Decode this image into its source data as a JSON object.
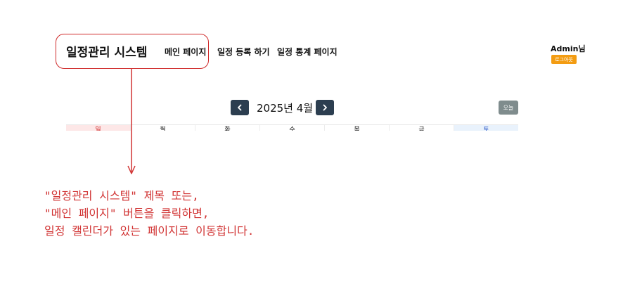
{
  "header": {
    "brand": "일정관리 시스템",
    "nav": [
      {
        "label": "메인 페이지"
      },
      {
        "label": "일정 등록 하기"
      },
      {
        "label": "일정 통계 페이지"
      }
    ],
    "user": "Admin님",
    "logout_label": "로그아웃"
  },
  "calendar": {
    "title": "2025년 4월",
    "today_label": "오늘",
    "weekdays": [
      "일",
      "월",
      "화",
      "수",
      "목",
      "금",
      "토"
    ]
  },
  "annotation": {
    "lines": [
      "\"일정관리 시스템\" 제목 또는,",
      "\"메인 페이지\" 버튼을 클릭하면,",
      "일정 캘린더가 있는 페이지로 이동합니다."
    ],
    "color": "#d13434"
  },
  "colors": {
    "nav_button": "#2c3e50",
    "logout": "#f39c12",
    "today": "#7f8c8d",
    "sunday_bg": "#fde7e7",
    "saturday_bg": "#e9f2fc"
  }
}
